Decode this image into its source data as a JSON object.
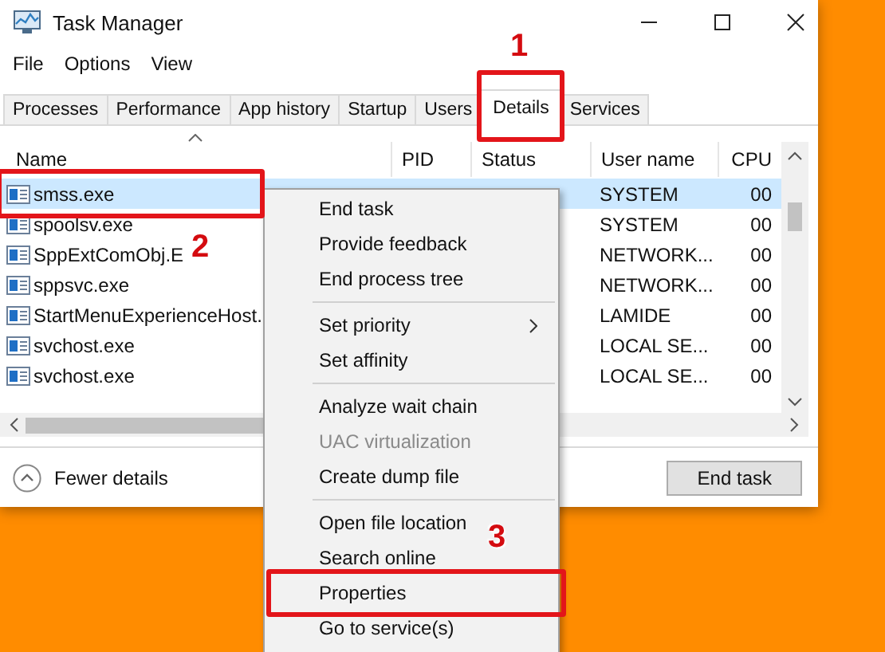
{
  "window": {
    "title": "Task Manager"
  },
  "menu_bar": [
    "File",
    "Options",
    "View"
  ],
  "tabs": [
    {
      "label": "Processes",
      "selected": false
    },
    {
      "label": "Performance",
      "selected": false
    },
    {
      "label": "App history",
      "selected": false
    },
    {
      "label": "Startup",
      "selected": false
    },
    {
      "label": "Users",
      "selected": false
    },
    {
      "label": "Details",
      "selected": true
    },
    {
      "label": "Services",
      "selected": false
    }
  ],
  "table": {
    "columns": [
      "Name",
      "PID",
      "Status",
      "User name",
      "CPU"
    ],
    "rows": [
      {
        "name": "smss.exe",
        "user": "SYSTEM",
        "cpu": "00",
        "selected": true
      },
      {
        "name": "spoolsv.exe",
        "user": "SYSTEM",
        "cpu": "00",
        "selected": false
      },
      {
        "name": "SppExtComObj.E",
        "user": "NETWORK...",
        "cpu": "00",
        "selected": false
      },
      {
        "name": "sppsvc.exe",
        "user": "NETWORK...",
        "cpu": "00",
        "selected": false
      },
      {
        "name": "StartMenuExperienceHost.",
        "user": "LAMIDE",
        "cpu": "00",
        "selected": false
      },
      {
        "name": "svchost.exe",
        "user": "LOCAL SE...",
        "cpu": "00",
        "selected": false
      },
      {
        "name": "svchost.exe",
        "user": "LOCAL SE...",
        "cpu": "00",
        "selected": false
      }
    ]
  },
  "footer": {
    "fewer_details": "Fewer details",
    "end_task": "End task"
  },
  "context_menu": [
    {
      "kind": "item",
      "label": "End task",
      "disabled": false,
      "submenu": false
    },
    {
      "kind": "item",
      "label": "Provide feedback",
      "disabled": false,
      "submenu": false
    },
    {
      "kind": "item",
      "label": "End process tree",
      "disabled": false,
      "submenu": false
    },
    {
      "kind": "separator"
    },
    {
      "kind": "item",
      "label": "Set priority",
      "disabled": false,
      "submenu": true
    },
    {
      "kind": "item",
      "label": "Set affinity",
      "disabled": false,
      "submenu": false
    },
    {
      "kind": "separator"
    },
    {
      "kind": "item",
      "label": "Analyze wait chain",
      "disabled": false,
      "submenu": false
    },
    {
      "kind": "item",
      "label": "UAC virtualization",
      "disabled": true,
      "submenu": false
    },
    {
      "kind": "item",
      "label": "Create dump file",
      "disabled": false,
      "submenu": false
    },
    {
      "kind": "separator"
    },
    {
      "kind": "item",
      "label": "Open file location",
      "disabled": false,
      "submenu": false
    },
    {
      "kind": "item",
      "label": "Search online",
      "disabled": false,
      "submenu": false
    },
    {
      "kind": "item",
      "label": "Properties",
      "disabled": false,
      "submenu": false
    },
    {
      "kind": "item",
      "label": "Go to service(s)",
      "disabled": false,
      "submenu": false
    }
  ],
  "annotations": [
    {
      "label": "1"
    },
    {
      "label": "2"
    },
    {
      "label": "3"
    }
  ]
}
